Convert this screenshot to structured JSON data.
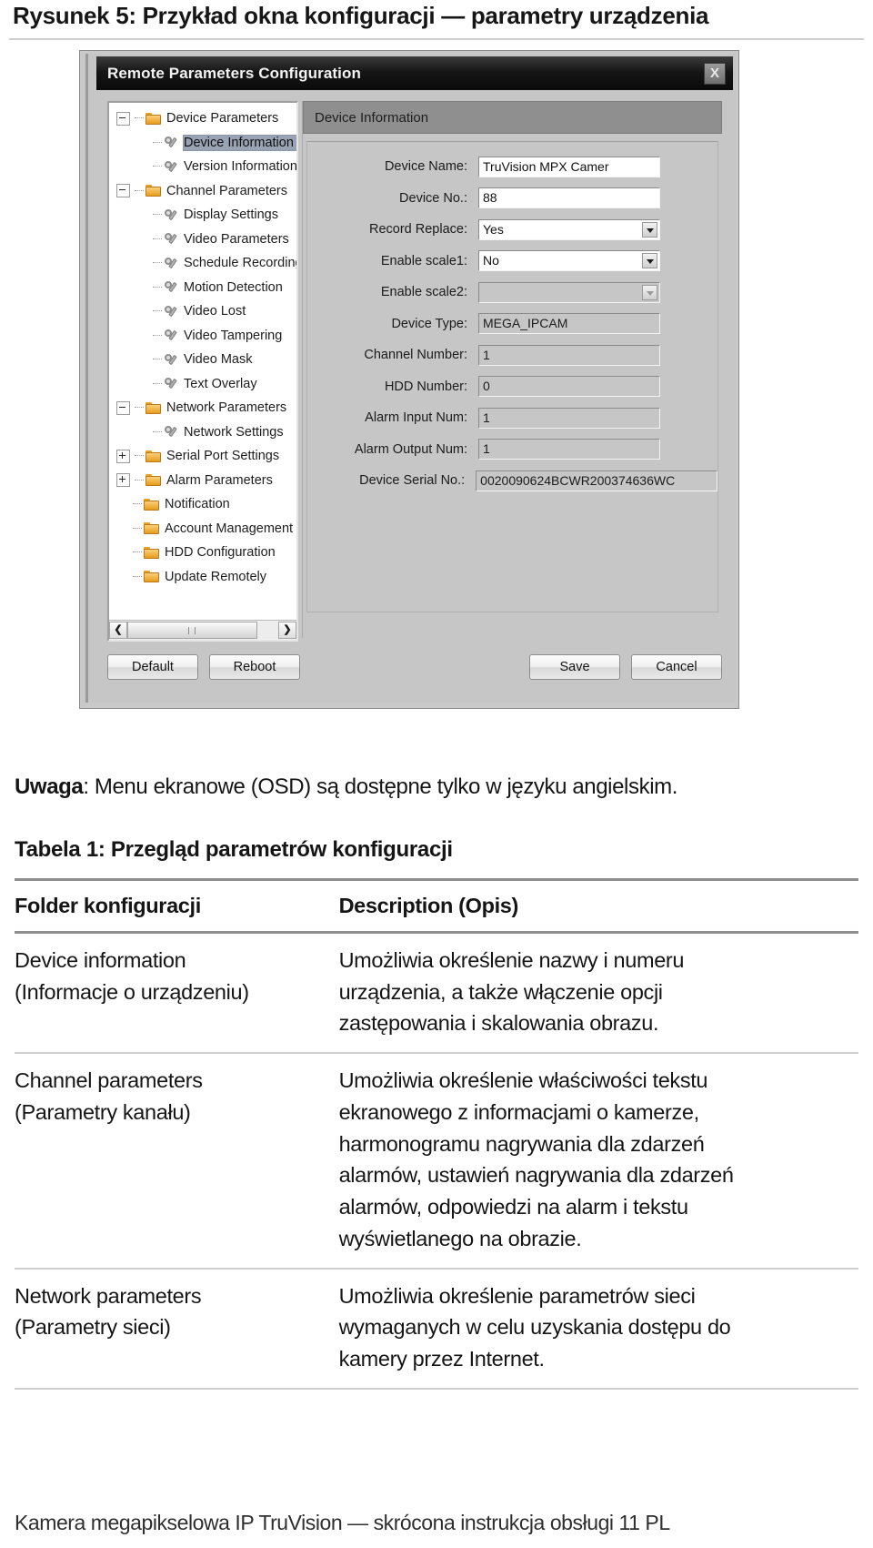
{
  "figure_caption": "Rysunek 5: Przykład okna konfiguracji — parametry urządzenia",
  "dialog": {
    "title": "Remote Parameters Configuration",
    "close_label": "X",
    "tree": {
      "items": [
        {
          "label": "Device Parameters",
          "level": 0,
          "icon": "folder-icon",
          "expander": "minus",
          "selected": false
        },
        {
          "label": "Device Information",
          "level": 1,
          "icon": "wrench-icon",
          "expander": "none",
          "selected": true
        },
        {
          "label": "Version Information",
          "level": 1,
          "icon": "wrench-icon",
          "expander": "none",
          "selected": false
        },
        {
          "label": "Channel Parameters",
          "level": 0,
          "icon": "folder-icon",
          "expander": "minus",
          "selected": false
        },
        {
          "label": "Display Settings",
          "level": 1,
          "icon": "wrench-icon",
          "expander": "none",
          "selected": false
        },
        {
          "label": "Video Parameters",
          "level": 1,
          "icon": "wrench-icon",
          "expander": "none",
          "selected": false
        },
        {
          "label": "Schedule Recording",
          "level": 1,
          "icon": "wrench-icon",
          "expander": "none",
          "selected": false
        },
        {
          "label": "Motion Detection",
          "level": 1,
          "icon": "wrench-icon",
          "expander": "none",
          "selected": false
        },
        {
          "label": "Video Lost",
          "level": 1,
          "icon": "wrench-icon",
          "expander": "none",
          "selected": false
        },
        {
          "label": "Video Tampering",
          "level": 1,
          "icon": "wrench-icon",
          "expander": "none",
          "selected": false
        },
        {
          "label": "Video Mask",
          "level": 1,
          "icon": "wrench-icon",
          "expander": "none",
          "selected": false
        },
        {
          "label": "Text Overlay",
          "level": 1,
          "icon": "wrench-icon",
          "expander": "none",
          "selected": false
        },
        {
          "label": "Network Parameters",
          "level": 0,
          "icon": "folder-icon",
          "expander": "minus",
          "selected": false
        },
        {
          "label": "Network Settings",
          "level": 1,
          "icon": "wrench-icon",
          "expander": "none",
          "selected": false
        },
        {
          "label": "Serial Port Settings",
          "level": 0,
          "icon": "folder-icon",
          "expander": "plus",
          "selected": false
        },
        {
          "label": "Alarm Parameters",
          "level": 0,
          "icon": "folder-icon",
          "expander": "plus",
          "selected": false
        },
        {
          "label": "Notification",
          "level": 0,
          "icon": "folder-icon",
          "expander": "none",
          "selected": false
        },
        {
          "label": "Account Management",
          "level": 0,
          "icon": "folder-icon",
          "expander": "none",
          "selected": false
        },
        {
          "label": "HDD Configuration",
          "level": 0,
          "icon": "folder-icon",
          "expander": "none",
          "selected": false
        },
        {
          "label": "Update Remotely",
          "level": 0,
          "icon": "folder-icon",
          "expander": "none",
          "selected": false
        }
      ],
      "hscroll": {
        "left_arrow": "❮",
        "right_arrow": "❯"
      }
    },
    "panel": {
      "header": "Device Information",
      "fields": [
        {
          "label": "Device Name:",
          "value": "TruVision MPX Camer",
          "type": "text",
          "state": "editable"
        },
        {
          "label": "Device No.:",
          "value": "88",
          "type": "text",
          "state": "editable"
        },
        {
          "label": "Record Replace:",
          "value": "Yes",
          "type": "select",
          "state": "editable"
        },
        {
          "label": "Enable scale1:",
          "value": "No",
          "type": "select",
          "state": "editable"
        },
        {
          "label": "Enable scale2:",
          "value": "",
          "type": "select",
          "state": "disabled"
        },
        {
          "label": "Device Type:",
          "value": "MEGA_IPCAM",
          "type": "text",
          "state": "readonly"
        },
        {
          "label": "Channel Number:",
          "value": "1",
          "type": "text",
          "state": "readonly"
        },
        {
          "label": "HDD Number:",
          "value": "0",
          "type": "text",
          "state": "readonly"
        },
        {
          "label": "Alarm Input Num:",
          "value": "1",
          "type": "text",
          "state": "readonly"
        },
        {
          "label": "Alarm Output Num:",
          "value": "1",
          "type": "text",
          "state": "readonly"
        },
        {
          "label": "Device Serial No.:",
          "value": "0020090624BCWR200374636WC",
          "type": "text",
          "state": "readonly",
          "wide": true
        }
      ]
    },
    "buttons": {
      "default": "Default",
      "reboot": "Reboot",
      "save": "Save",
      "cancel": "Cancel"
    }
  },
  "note": {
    "bold_prefix": "Uwaga",
    "text": ": Menu ekranowe (OSD) są dostępne tylko w języku angielskim."
  },
  "table": {
    "title": "Tabela 1: Przegląd parametrów konfiguracji",
    "headers": {
      "col_a": "Folder konfiguracji",
      "col_b": "Description (Opis)"
    },
    "rows": [
      {
        "folder_lines": [
          "Device information",
          "(Informacje o urządzeniu)"
        ],
        "desc_lines": [
          "Umożliwia określenie nazwy i numeru",
          "urządzenia, a także włączenie opcji",
          "zastępowania i skalowania obrazu."
        ]
      },
      {
        "folder_lines": [
          "Channel parameters",
          "(Parametry kanału)"
        ],
        "desc_lines": [
          "Umożliwia określenie właściwości tekstu",
          "ekranowego z informacjami o kamerze,",
          "harmonogramu nagrywania dla zdarzeń",
          "alarmów, ustawień nagrywania dla zdarzeń",
          "alarmów, odpowiedzi na alarm i tekstu",
          "wyświetlanego na obrazie."
        ]
      },
      {
        "folder_lines": [
          "Network parameters",
          "(Parametry sieci)"
        ],
        "desc_lines": [
          "Umożliwia określenie parametrów sieci",
          "wymaganych w celu uzyskania dostępu do",
          "kamery przez Internet."
        ]
      }
    ]
  },
  "footer": "Kamera megapikselowa IP TruVision — skrócona instrukcja obsługi  11 PL"
}
